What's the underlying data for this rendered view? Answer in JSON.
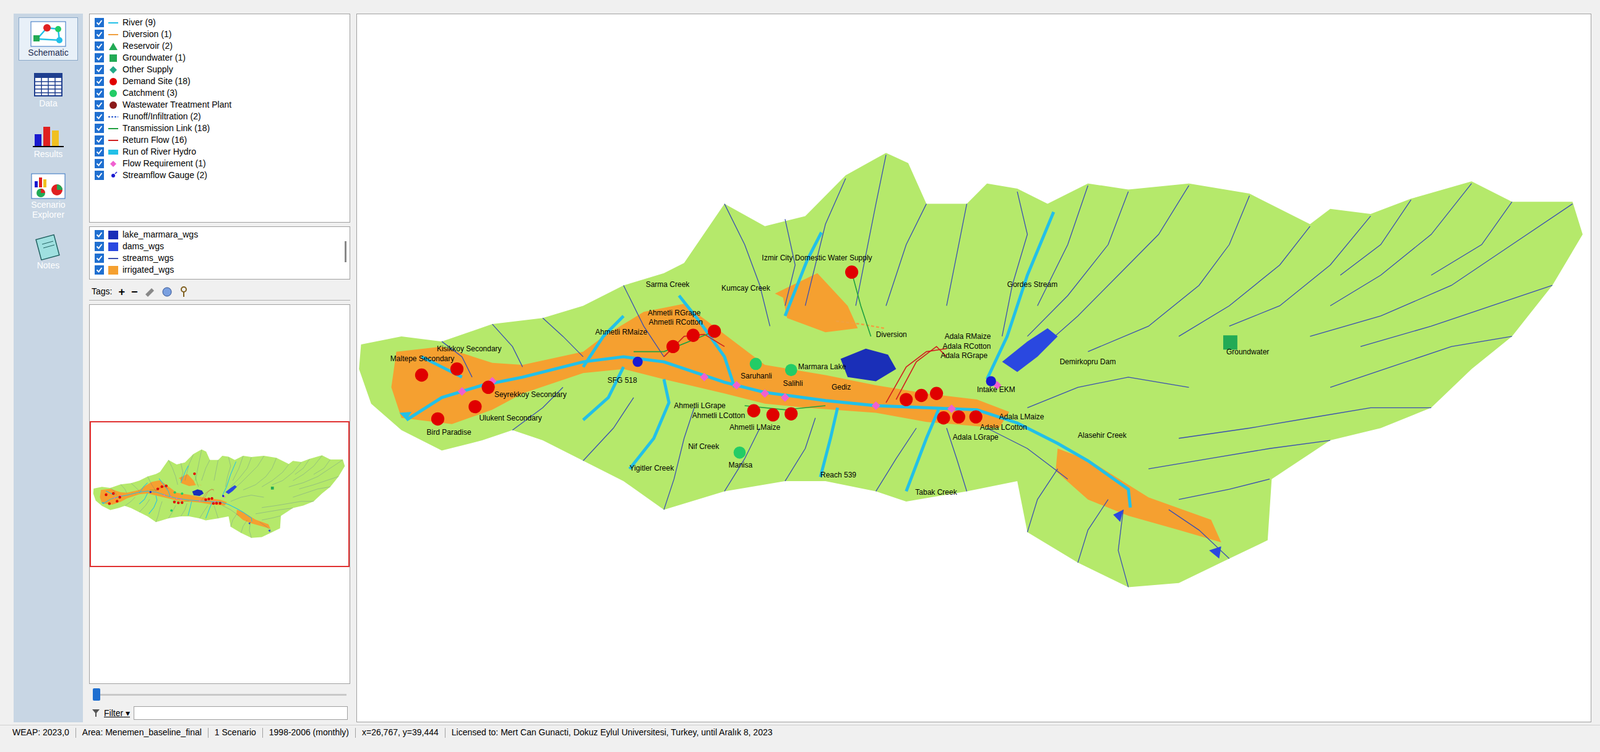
{
  "toolbar": [
    {
      "label": "Schematic",
      "selected": true
    },
    {
      "label": "Data",
      "selected": false
    },
    {
      "label": "Results",
      "selected": false
    },
    {
      "label": "Scenario Explorer",
      "selected": false
    },
    {
      "label": "Notes",
      "selected": false
    }
  ],
  "legend": [
    {
      "label": "River (9)",
      "checked": true,
      "kind": "river"
    },
    {
      "label": "Diversion (1)",
      "checked": true,
      "kind": "diversion"
    },
    {
      "label": "Reservoir (2)",
      "checked": true,
      "kind": "reservoir"
    },
    {
      "label": "Groundwater (1)",
      "checked": true,
      "kind": "groundwater"
    },
    {
      "label": "Other Supply",
      "checked": true,
      "kind": "othersupply"
    },
    {
      "label": "Demand Site (18)",
      "checked": true,
      "kind": "demand"
    },
    {
      "label": "Catchment (3)",
      "checked": true,
      "kind": "catchment"
    },
    {
      "label": "Wastewater Treatment Plant",
      "checked": true,
      "kind": "wwtp"
    },
    {
      "label": "Runoff/Infiltration (2)",
      "checked": true,
      "kind": "runoff"
    },
    {
      "label": "Transmission Link (18)",
      "checked": true,
      "kind": "transmission"
    },
    {
      "label": "Return Flow (16)",
      "checked": true,
      "kind": "returnflow"
    },
    {
      "label": "Run of River Hydro",
      "checked": true,
      "kind": "hydro"
    },
    {
      "label": "Flow Requirement (1)",
      "checked": true,
      "kind": "flowreq"
    },
    {
      "label": "Streamflow Gauge (2)",
      "checked": true,
      "kind": "gauge"
    }
  ],
  "layers": [
    {
      "label": "lake_marmara_wgs",
      "checked": true,
      "kind": "fill",
      "color": "#1a2fb8"
    },
    {
      "label": "dams_wgs",
      "checked": true,
      "kind": "fill",
      "color": "#2a48e0"
    },
    {
      "label": "streams_wgs",
      "checked": true,
      "kind": "line",
      "color": "#3a4fb0"
    },
    {
      "label": "irrigated_wgs",
      "checked": true,
      "kind": "fill",
      "color": "#f5a030"
    }
  ],
  "tags": {
    "label": "Tags:",
    "buttons": [
      "+",
      "−"
    ]
  },
  "slider": {
    "level": 0
  },
  "filter": {
    "label": "Filter",
    "arrow": "▾"
  },
  "map": {
    "labels": [
      "Izmir City Domestic Water Supply",
      "Sarma Creek",
      "Kumcay Creek",
      "Gordes Stream",
      "Ahmetli RGrape",
      "Ahmetli RCotton",
      "Ahmetli RMaize",
      "Diversion",
      "Adala RMaize",
      "Adala RCotton",
      "Adala RGrape",
      "Kisikkoy Secondary",
      "Maltepe Secondary",
      "Demirkopru Dam",
      "Groundwater",
      "Marmara Lake",
      "Saruhanli",
      "Salihli",
      "SFG 518",
      "Gediz",
      "Intake",
      "EKM",
      "Seyrekkoy Secondary",
      "Ahmetli LGrape",
      "Ahmetli LCotton",
      "Ahmetli LMaize",
      "Adala LMaize",
      "Adala LCotton",
      "Adala LGrape",
      "Ulukent Secondary",
      "Bird Paradise",
      "Alasehir Creek",
      "Nif Creek",
      "Manisa",
      "Yigitler Creek",
      "Reach 539",
      "Tabak Creek"
    ]
  },
  "status_bar": [
    "WEAP: 2023,0",
    "Area: Menemen_baseline_final",
    "1 Scenario",
    "1998-2006 (monthly)",
    "x=26,767, y=39,444",
    "Licensed to: Mert Can Gunacti, Dokuz Eylul Universitesi, Turkey, until Aralık 8, 2023"
  ]
}
